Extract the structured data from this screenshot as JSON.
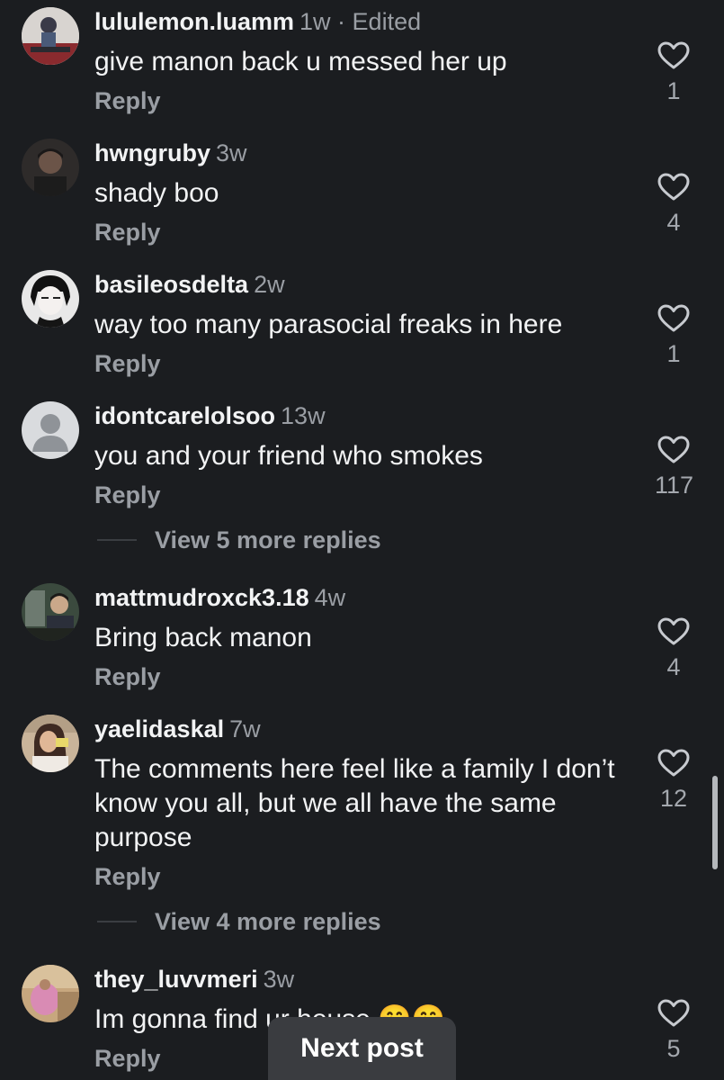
{
  "comments": [
    {
      "username": "lululemon.luamm",
      "time": "1w",
      "edited": " · Edited",
      "text": "give manon back u messed her up",
      "reply": "Reply",
      "likes": "1",
      "avatar": "avatar-photo"
    },
    {
      "username": "hwngruby",
      "time": "3w",
      "edited": "",
      "text": "shady boo",
      "reply": "Reply",
      "likes": "4",
      "avatar": "avatar-photo"
    },
    {
      "username": "basileosdelta",
      "time": "2w",
      "edited": "",
      "text": "way too many parasocial freaks in here",
      "reply": "Reply",
      "likes": "1",
      "avatar": "avatar-illustration"
    },
    {
      "username": "idontcarelolsoo",
      "time": "13w",
      "edited": "",
      "text": "you and your friend who smokes",
      "reply": "Reply",
      "likes": "117",
      "avatar": "default-avatar-icon"
    },
    {
      "username": "mattmudroxck3.18",
      "time": "4w",
      "edited": "",
      "text": "Bring back manon",
      "reply": "Reply",
      "likes": "4",
      "avatar": "avatar-photo"
    },
    {
      "username": "yaelidaskal",
      "time": "7w",
      "edited": "",
      "text": "The comments here feel like a family I don’t know you all, but we all have the same purpose",
      "reply": "Reply",
      "likes": "12",
      "avatar": "avatar-photo"
    },
    {
      "username": "they_luvvmeri",
      "time": "3w",
      "edited": "",
      "text": "Im gonna find ur house 🤭🤭",
      "reply": "Reply",
      "likes": "5",
      "avatar": "avatar-photo"
    }
  ],
  "view_more": [
    {
      "label": "View 5 more replies"
    },
    {
      "label": "View 4 more replies"
    }
  ],
  "next_post_label": "Next post",
  "icons": {
    "like": "heart-outline-icon"
  },
  "colors": {
    "background": "#1b1d20",
    "primary_text": "#f2f3f4",
    "secondary_text": "#9a9ea4",
    "button": "#3a3c40"
  }
}
